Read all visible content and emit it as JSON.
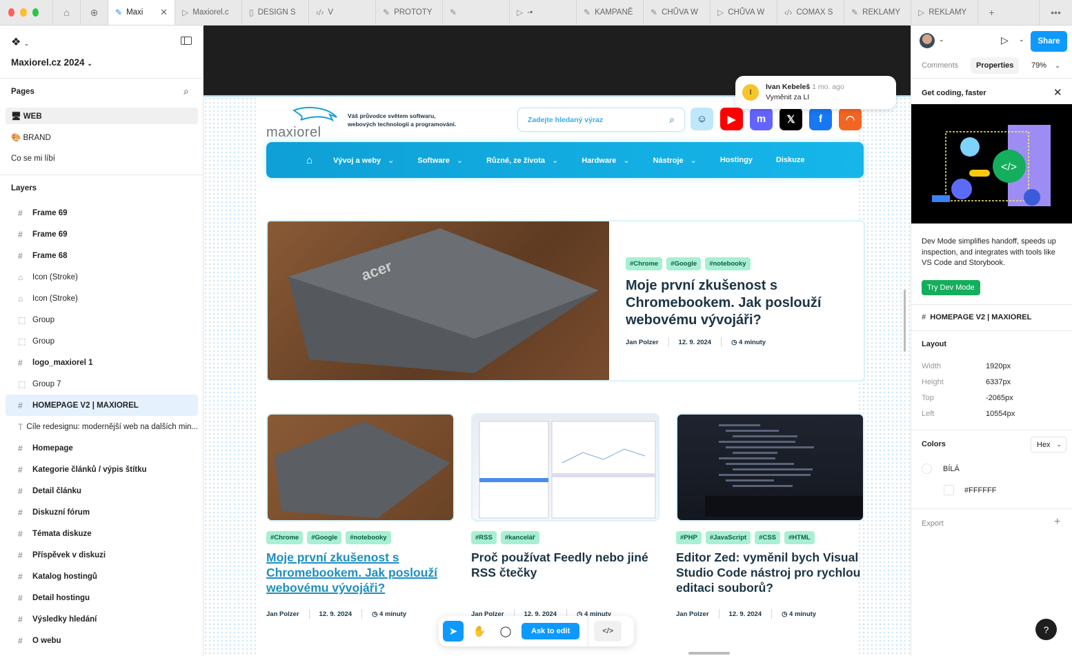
{
  "tabbar": {
    "tabs": [
      {
        "icon": "figma-file-icon",
        "label": "Maxi",
        "active": true
      },
      {
        "icon": "play-icon",
        "label": "Maxiorel.c"
      },
      {
        "icon": "book-icon",
        "label": "DESIGN S"
      },
      {
        "icon": "code-icon",
        "label": "V"
      },
      {
        "icon": "figma-file-icon",
        "label": "PROTOTY"
      },
      {
        "icon": "figma-file-icon",
        "label": ""
      },
      {
        "icon": "play-icon",
        "label": "-▪"
      },
      {
        "icon": "figma-file-icon",
        "label": "KAMPANĚ"
      },
      {
        "icon": "figma-file-icon",
        "label": "CHŮVA W"
      },
      {
        "icon": "play-icon",
        "label": "CHŮVA W"
      },
      {
        "icon": "code-icon",
        "label": "COMAX S"
      },
      {
        "icon": "figma-file-icon",
        "label": "REKLAMY"
      },
      {
        "icon": "play-icon",
        "label": "REKLAMY"
      }
    ],
    "new_tab": "+",
    "more": "•••"
  },
  "left": {
    "file_name": "Maxiorel.cz 2024",
    "pages_title": "Pages",
    "pages": [
      {
        "label": "🖥 WEB",
        "selected": true
      },
      {
        "label": "🎨 BRAND"
      },
      {
        "label": "Co se mi líbí"
      }
    ],
    "layers_title": "Layers",
    "layers": [
      {
        "icon": "#",
        "label": "Frame 69",
        "type": "frame"
      },
      {
        "icon": "#",
        "label": "Frame 69",
        "type": "frame"
      },
      {
        "icon": "#",
        "label": "Frame 68",
        "type": "frame"
      },
      {
        "icon": "⌂",
        "label": "Icon (Stroke)",
        "type": "component"
      },
      {
        "icon": "⌂",
        "label": "Icon (Stroke)",
        "type": "component"
      },
      {
        "icon": "⬚",
        "label": "Group",
        "type": "group"
      },
      {
        "icon": "⬚",
        "label": "Group",
        "type": "group"
      },
      {
        "icon": "#",
        "label": "logo_maxiorel 1",
        "type": "frame"
      },
      {
        "icon": "⬚",
        "label": "Group 7",
        "type": "group"
      },
      {
        "icon": "#",
        "label": "HOMEPAGE V2 | MAXIOREL",
        "type": "frame",
        "selected": true
      },
      {
        "icon": "T",
        "label": "Cíle redesignu: modernější web na dalších min...",
        "type": "text"
      },
      {
        "icon": "#",
        "label": "Homepage",
        "type": "frame"
      },
      {
        "icon": "#",
        "label": "Kategorie článků / výpis štítku",
        "type": "frame"
      },
      {
        "icon": "#",
        "label": "Detail článku",
        "type": "frame"
      },
      {
        "icon": "#",
        "label": "Diskuzní fórum",
        "type": "frame"
      },
      {
        "icon": "#",
        "label": "Témata diskuze",
        "type": "frame"
      },
      {
        "icon": "#",
        "label": "Příspěvek v diskuzi",
        "type": "frame"
      },
      {
        "icon": "#",
        "label": "Katalog hostingů",
        "type": "frame"
      },
      {
        "icon": "#",
        "label": "Detail hostingu",
        "type": "frame"
      },
      {
        "icon": "#",
        "label": "Výsledky hledání",
        "type": "frame"
      },
      {
        "icon": "#",
        "label": "O webu",
        "type": "frame"
      }
    ]
  },
  "site": {
    "logo": "maxiorel",
    "tagline_1": "Váš průvodce světem softwaru,",
    "tagline_2": "webových technologií a programování.",
    "search_placeholder": "Zadejte hledaný výraz",
    "nav": [
      "Vývoj a weby",
      "Software",
      "Různé, ze života",
      "Hardware",
      "Nástroje",
      "Hostingy",
      "Diskuze"
    ],
    "nav_dropdown": [
      true,
      true,
      true,
      true,
      true,
      false,
      false
    ],
    "featured": {
      "tags": [
        "#Chrome",
        "#Google",
        "#notebooky"
      ],
      "title": "Moje první zkušenost s Chromebookem. Jak poslouží webovému vývojáři?",
      "author": "Jan Polzer",
      "date": "12. 9. 2024",
      "read": "4 minuty",
      "image_text": "acer"
    },
    "articles": [
      {
        "tags": [
          "#Chrome",
          "#Google",
          "#notebooky"
        ],
        "title": "Moje první zkušenost s Chromebookem. Jak poslouží webovému vývojáři?",
        "author": "Jan Polzer",
        "date": "12. 9. 2024",
        "read": "4 minuty",
        "hovered": true
      },
      {
        "tags": [
          "#RSS",
          "#kancelář"
        ],
        "title": "Proč používat Feedly nebo jiné RSS čtečky",
        "author": "Jan Polzer",
        "date": "12. 9. 2024",
        "read": "4 minuty"
      },
      {
        "tags": [
          "#PHP",
          "#JavaScript",
          "#CSS",
          "#HTML"
        ],
        "title": "Editor Zed: vyměnil bych Visual Studio Code nástroj pro rychlou editaci souborů?",
        "author": "Jan Polzer",
        "date": "12. 9. 2024",
        "read": "4 minuty"
      }
    ]
  },
  "comment": {
    "avatar_initial": "I",
    "author": "Ivan Kebeleš",
    "time": "1 mo. ago",
    "text": "Vyměnit za LI"
  },
  "toolbar": {
    "ask_to_edit": "Ask to edit"
  },
  "right": {
    "share": "Share",
    "tab_comments": "Comments",
    "tab_properties": "Properties",
    "zoom": "79%",
    "promo_title": "Get coding, faster",
    "promo_text": "Dev Mode simplifies handoff, speeds up inspection, and integrates with tools like VS Code and Storybook.",
    "promo_button": "Try Dev Mode",
    "frame_name": "HOMEPAGE V2 | MAXIOREL",
    "layout_title": "Layout",
    "layout": [
      {
        "k": "Width",
        "v": "1920px"
      },
      {
        "k": "Height",
        "v": "6337px"
      },
      {
        "k": "Top",
        "v": "-2065px"
      },
      {
        "k": "Left",
        "v": "10554px"
      }
    ],
    "colors_title": "Colors",
    "color_format": "Hex",
    "color_name": "BÍLÁ",
    "color_value": "#FFFFFF",
    "export_title": "Export"
  },
  "help": "?",
  "colors": {
    "accent": "#0d99ff",
    "nav": "#12aee2",
    "tag": "#a8f0d3",
    "heading": "#1b3445",
    "link": "#1d8fc0"
  }
}
